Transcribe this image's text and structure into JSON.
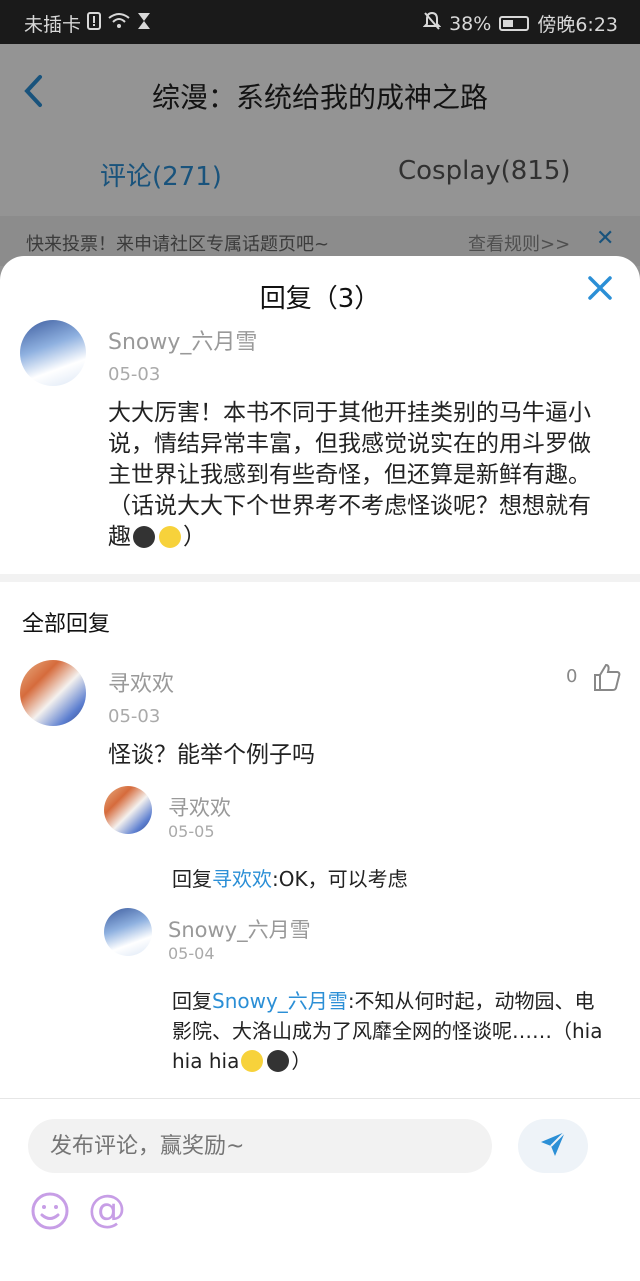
{
  "status_bar": {
    "left_text": "未插卡",
    "battery_percent": "38%",
    "time": "傍晚6:23",
    "battery_level": 0.38
  },
  "app_bar": {
    "title": "综漫：系统给我的成神之路",
    "back_icon": "chevron-left-icon"
  },
  "tabs": [
    {
      "label": "评论(271)",
      "active": true
    },
    {
      "label": "Cosplay(815)",
      "active": false
    }
  ],
  "notice": {
    "text": "快来投票！来申请社区专属话题页吧~",
    "rules_link": "查看规则>>"
  },
  "sheet": {
    "title": "回复（3）",
    "main_comment": {
      "user": "Snowy_六月雪",
      "date": "05-03",
      "text_before_emoji": "大大厉害！本书不同于其他开挂类别的马牛逼小说，情结异常丰富，但我感觉说实在的用斗罗做主世界让我感到有些奇怪，但还算是新鲜有趣。（话说大大下个世界考不考虑怪谈呢？想想就有趣",
      "text_after_emoji": "）"
    },
    "section_title": "全部回复",
    "reply": {
      "user": "寻欢欢",
      "date": "05-03",
      "likes": "0",
      "text": "怪谈？能举个例子吗",
      "sub_replies": [
        {
          "user": "寻欢欢",
          "date": "05-05",
          "prefix": "回复",
          "mention": "寻欢欢",
          "text": ":OK，可以考虑"
        },
        {
          "user": "Snowy_六月雪",
          "date": "05-04",
          "prefix": "回复",
          "mention": "Snowy_六月雪",
          "text": ":不知从何时起，动物园、电影院、大洛山成为了风靡全网的怪谈呢……（hia hia hia",
          "text_after_emoji": "）"
        }
      ]
    }
  },
  "bottom": {
    "input_placeholder": "发布评论，赢奖励~",
    "at_symbol": "@"
  },
  "colors": {
    "accent": "#2b8fd6",
    "status_bar_bg": "#1a1a1a"
  }
}
